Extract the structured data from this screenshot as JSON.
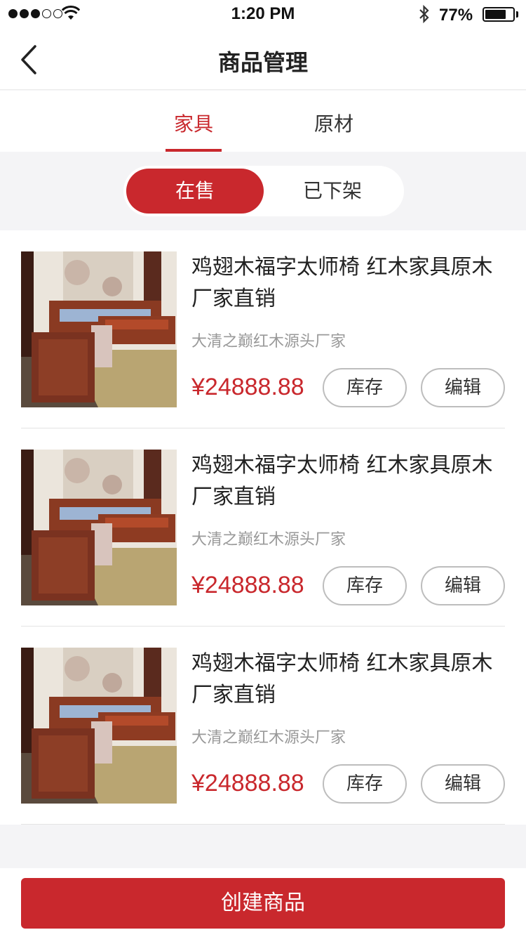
{
  "status_bar": {
    "time": "1:20 PM",
    "battery": "77%",
    "battery_level": 0.77,
    "signal_bars_filled": 3,
    "signal_bars_total": 5
  },
  "nav": {
    "title": "商品管理",
    "back_icon": "chevron-left-icon"
  },
  "tabs": [
    {
      "label": "家具",
      "active": true
    },
    {
      "label": "原材",
      "active": false
    }
  ],
  "segments": [
    {
      "label": "在售",
      "active": true
    },
    {
      "label": "已下架",
      "active": false
    }
  ],
  "products": [
    {
      "title": "鸡翅木福字太师椅 红木家具原木厂家直销",
      "shop": "大清之巅红木源头厂家",
      "price": "¥24888.88",
      "stock_label": "库存",
      "edit_label": "编辑"
    },
    {
      "title": "鸡翅木福字太师椅 红木家具原木厂家直销",
      "shop": "大清之巅红木源头厂家",
      "price": "¥24888.88",
      "stock_label": "库存",
      "edit_label": "编辑"
    },
    {
      "title": "鸡翅木福字太师椅 红木家具原木厂家直销",
      "shop": "大清之巅红木源头厂家",
      "price": "¥24888.88",
      "stock_label": "库存",
      "edit_label": "编辑"
    }
  ],
  "create_button": "创建商品",
  "colors": {
    "accent": "#c9282d",
    "background": "#f4f4f6"
  }
}
